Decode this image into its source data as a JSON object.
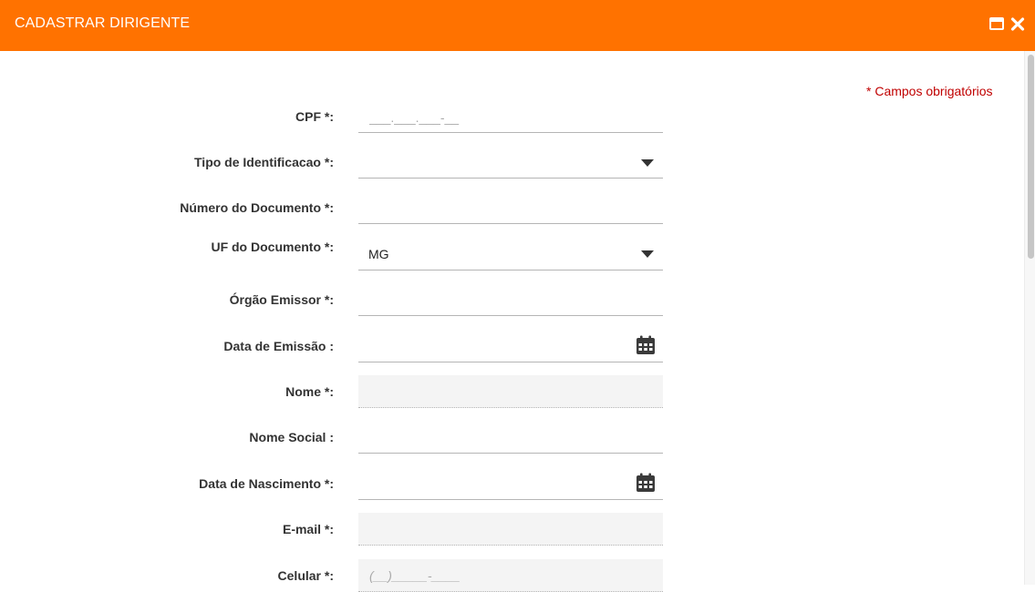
{
  "window": {
    "title": "CADASTRAR DIRIGENTE",
    "header_color": "#ff7200",
    "maximize_icon": "window-maximize-icon",
    "close_icon": "close-icon"
  },
  "form": {
    "required_note": "* Campos obrigatórios",
    "fields": {
      "cpf": {
        "label": "CPF *:",
        "placeholder": "___.___.___-__",
        "value": ""
      },
      "tipo_identificacao": {
        "label": "Tipo de Identificacao *:",
        "value": ""
      },
      "numero_documento": {
        "label": "Número do Documento *:",
        "value": ""
      },
      "uf_documento": {
        "label": "UF do Documento *:",
        "value": "MG"
      },
      "orgao_emissor": {
        "label": "Órgão Emissor *:",
        "value": ""
      },
      "data_emissao": {
        "label": "Data de Emissão :",
        "value": ""
      },
      "nome": {
        "label": "Nome *:",
        "value": ""
      },
      "nome_social": {
        "label": "Nome Social :",
        "value": ""
      },
      "data_nascimento": {
        "label": "Data de Nascimento *:",
        "value": ""
      },
      "email": {
        "label": "E-mail *:",
        "value": ""
      },
      "celular": {
        "label": "Celular *:",
        "placeholder": "(__)_____-____",
        "value": ""
      }
    }
  }
}
